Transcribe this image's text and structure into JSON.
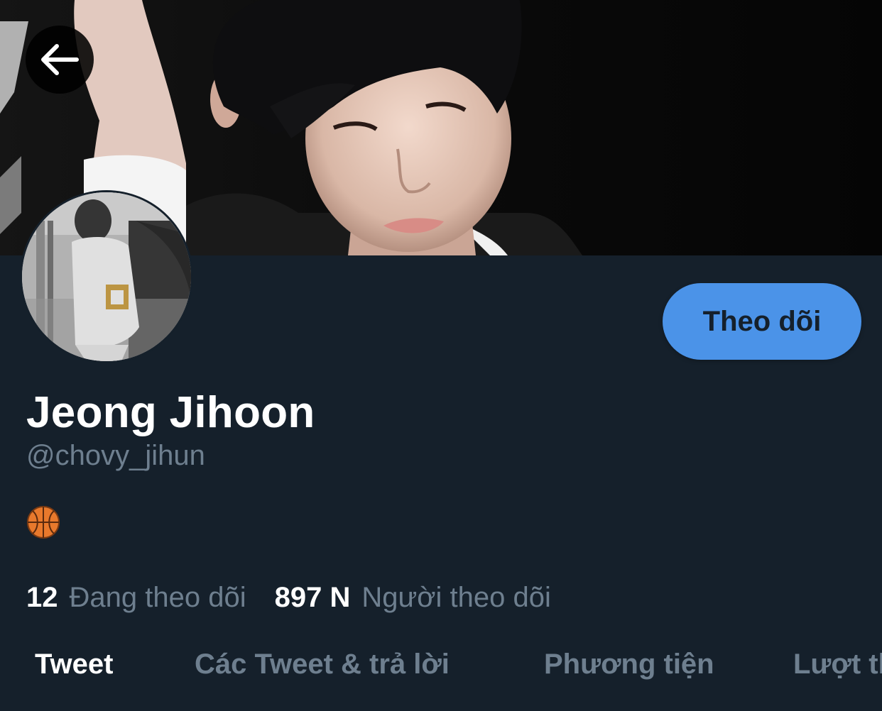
{
  "profile": {
    "name": "Jeong Jihoon",
    "handle": "@chovy_jihun",
    "bio_emoji": "basketball-icon",
    "follow_label": "Theo dõi"
  },
  "stats": {
    "following_count": "12",
    "following_label": "Đang theo dõi",
    "followers_count": "897 N",
    "followers_label": "Người theo dõi"
  },
  "tabs": [
    {
      "label": "Tweet",
      "active": true
    },
    {
      "label": "Các Tweet & trả lời",
      "active": false
    },
    {
      "label": "Phương tiện",
      "active": false
    },
    {
      "label": "Lượt thích",
      "active": false
    }
  ],
  "colors": {
    "background": "#15202b",
    "accent": "#4b93e8",
    "muted_text": "#6e7f8f",
    "primary_text": "#ffffff"
  }
}
